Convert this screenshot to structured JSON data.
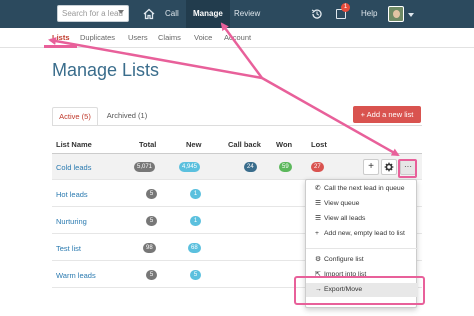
{
  "topbar": {
    "search_placeholder": "Search for a lead",
    "nav": {
      "call": "Call",
      "manage": "Manage",
      "review": "Review"
    },
    "calendar_badge": "1",
    "help": "Help"
  },
  "subnav": {
    "items": [
      "Lists",
      "Duplicates",
      "Users",
      "Claims",
      "Voice",
      "Account"
    ]
  },
  "page": {
    "title": "Manage Lists",
    "tabs": [
      "Active (5)",
      "Archived (1)"
    ],
    "add_button": "+ Add a new list"
  },
  "table": {
    "columns": [
      "List Name",
      "Total",
      "New",
      "Call back",
      "Won",
      "Lost"
    ],
    "rows": [
      {
        "name": "Cold leads",
        "total": "5,071",
        "new": "4,945",
        "callback": "24",
        "won": "59",
        "lost": "27"
      },
      {
        "name": "Hot leads",
        "total": "5",
        "new": "1",
        "callback": "",
        "won": "",
        "lost": ""
      },
      {
        "name": "Nurturing",
        "total": "5",
        "new": "1",
        "callback": "",
        "won": "",
        "lost": ""
      },
      {
        "name": "Test list",
        "total": "98",
        "new": "68",
        "callback": "",
        "won": "",
        "lost": ""
      },
      {
        "name": "Warm leads",
        "total": "5",
        "new": "5",
        "callback": "",
        "won": "",
        "lost": ""
      }
    ]
  },
  "actions": {
    "add": "+",
    "more": "···"
  },
  "menu": {
    "items": [
      "Call the next lead in queue",
      "View queue",
      "View all leads",
      "Add new, empty lead to list",
      "Configure list",
      "Import into list",
      "Export/Move"
    ]
  },
  "colors": {
    "navbar": "#2c4a5e",
    "accent_red": "#d9534f",
    "link_blue": "#2a7ab0",
    "annotation_pink": "#e8609a"
  }
}
